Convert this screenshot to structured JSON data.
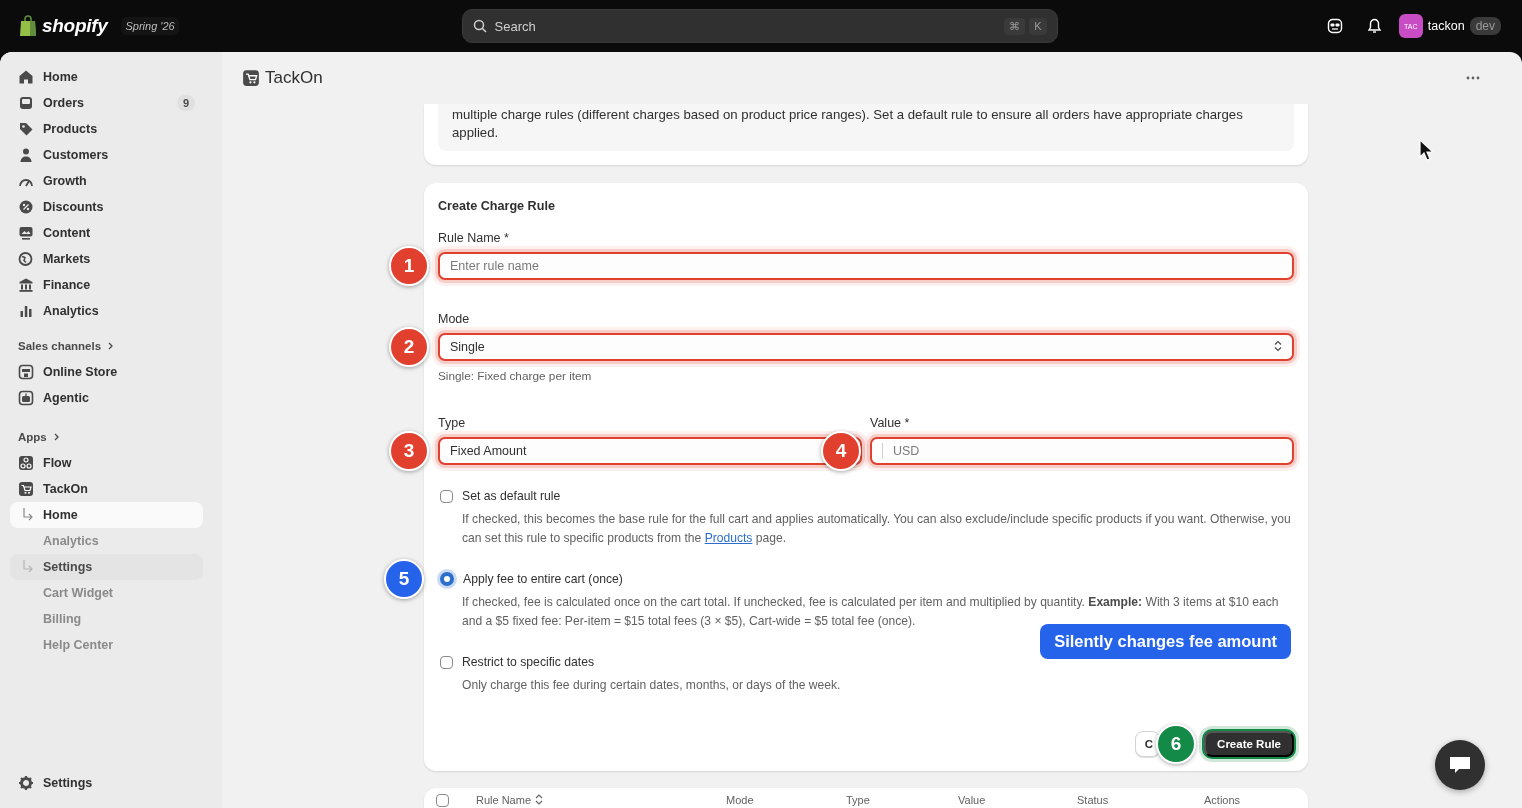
{
  "topbar": {
    "brand": "shopify",
    "release": "Spring '26",
    "search": {
      "placeholder": "Search",
      "keys": [
        "⌘",
        "K"
      ]
    },
    "store": {
      "initials": "TAC",
      "name": "tackon",
      "badge": "dev"
    }
  },
  "sidebar": {
    "items": [
      {
        "label": "Home"
      },
      {
        "label": "Orders",
        "count": "9"
      },
      {
        "label": "Products"
      },
      {
        "label": "Customers"
      },
      {
        "label": "Growth"
      },
      {
        "label": "Discounts"
      },
      {
        "label": "Content"
      },
      {
        "label": "Markets"
      },
      {
        "label": "Finance"
      },
      {
        "label": "Analytics"
      }
    ],
    "sales_channels": {
      "title": "Sales channels",
      "items": [
        {
          "label": "Online Store"
        },
        {
          "label": "Agentic"
        }
      ]
    },
    "apps": {
      "title": "Apps",
      "items": [
        {
          "label": "Flow"
        },
        {
          "label": "TackOn",
          "children": [
            {
              "label": "Home",
              "selected": true,
              "hovered": false
            },
            {
              "label": "Analytics",
              "selected": false,
              "hovered": false
            },
            {
              "label": "Settings",
              "selected": false,
              "hovered": true
            },
            {
              "label": "Cart Widget",
              "selected": false,
              "hovered": false
            },
            {
              "label": "Billing",
              "selected": false,
              "hovered": false
            },
            {
              "label": "Help Center",
              "selected": false,
              "hovered": false
            }
          ]
        }
      ]
    },
    "footer": {
      "label": "Settings"
    }
  },
  "app_header": {
    "title": "TackOn"
  },
  "info_card": {
    "text": "multiple charge rules (different charges based on product price ranges). Set a default rule to ensure all orders have appropriate charges applied."
  },
  "rule_form": {
    "title": "Create Charge Rule",
    "fields": [
      {
        "kind": "text",
        "label": "Rule Name *",
        "placeholder": "Enter rule name",
        "annotation": {
          "number": "1",
          "color": "#e2402f"
        }
      },
      {
        "kind": "select",
        "label": "Mode",
        "value": "Single",
        "help": "Single: Fixed charge per item",
        "annotation": {
          "number": "2",
          "color": "#e2402f"
        }
      },
      {
        "kind": "text",
        "label": "Type",
        "value": "Fixed Amount",
        "annotation": {
          "number": "3",
          "color": "#e2402f"
        }
      },
      {
        "kind": "text",
        "label": "Value *",
        "placeholder": "USD",
        "annotation": {
          "number": "4",
          "color": "#e2402f"
        }
      }
    ],
    "options": [
      {
        "kind": "checkbox",
        "label": "Set as default rule",
        "checked": false,
        "help": "If checked, this becomes the base rule for the full cart and applies automatically. You can also exclude/include specific products if you want. Otherwise, you can set this rule to specific products from the ",
        "link": "Products",
        "help_end": " page."
      },
      {
        "kind": "radio",
        "label": "Apply fee to entire cart (once)",
        "selected": true,
        "help": "If checked, fee is calculated once on the cart total. If unchecked, fee is calculated per item and multiplied by quantity. **Example:** With 3 items at $10 each and a $5 fixed fee: Per-item = $15 total fees (3 × $5), Cart-wide = $5 total fee (once).",
        "annotation": {
          "number": "5",
          "color": "#2563eb"
        }
      },
      {
        "kind": "checkbox",
        "label": "Restrict to specific dates",
        "checked": false,
        "help": "Only charge this fee during certain dates, months, or days of the week."
      }
    ],
    "callout": "Silently changes fee amount",
    "buttons": [
      {
        "kind": "secondary",
        "label": "C"
      },
      {
        "kind": "primary",
        "label": "Create Rule",
        "annotation": {
          "number": "6",
          "color": "#138a48"
        }
      }
    ]
  },
  "rules_table": {
    "select_all": {
      "checked": false
    },
    "columns": [
      {
        "label": "Rule Name",
        "sortable": true
      },
      {
        "label": "Mode",
        "sortable": false
      },
      {
        "label": "Type",
        "sortable": false
      },
      {
        "label": "Value",
        "sortable": false
      },
      {
        "label": "Status",
        "sortable": false
      },
      {
        "label": "Actions",
        "sortable": false
      }
    ]
  }
}
